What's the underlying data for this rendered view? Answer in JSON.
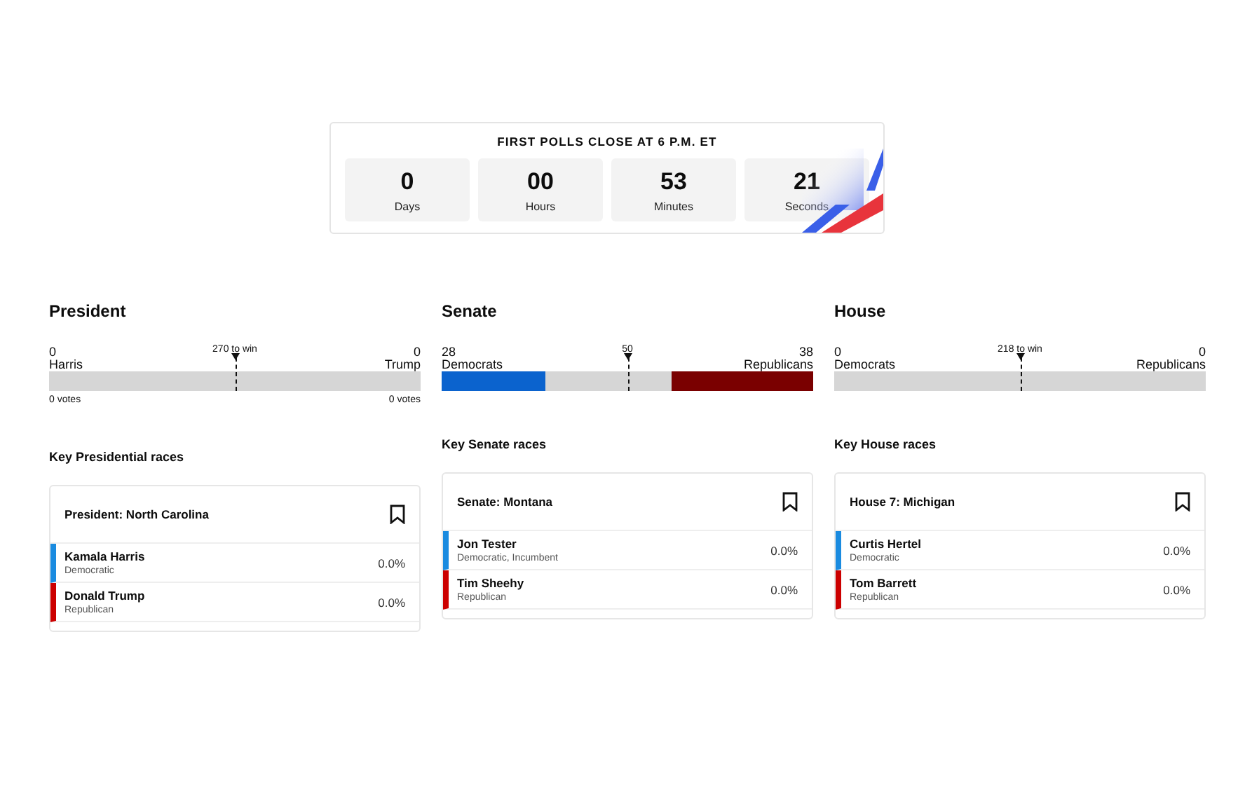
{
  "countdown": {
    "title": "FIRST POLLS CLOSE AT 6 P.M. ET",
    "units": [
      {
        "value": "0",
        "label": "Days"
      },
      {
        "value": "00",
        "label": "Hours"
      },
      {
        "value": "53",
        "label": "Minutes"
      },
      {
        "value": "21",
        "label": "Seconds"
      }
    ]
  },
  "sections": [
    {
      "title": "President",
      "left": {
        "count": "0",
        "name": "Harris",
        "votes": "0 votes"
      },
      "right": {
        "count": "0",
        "name": "Trump",
        "votes": "0 votes"
      },
      "marker": "270 to win",
      "key_title": "Key Presidential races",
      "race": {
        "title": "President: North Carolina",
        "candidates": [
          {
            "name": "Kamala Harris",
            "detail": "Democratic",
            "pct": "0.0%",
            "color": "#1a8be0"
          },
          {
            "name": "Donald Trump",
            "detail": "Republican",
            "pct": "0.0%",
            "color": "#cc0000"
          }
        ]
      }
    },
    {
      "title": "Senate",
      "left": {
        "count": "28",
        "name": "Democrats",
        "fill": {
          "level": 0.28
        }
      },
      "right": {
        "count": "38",
        "name": "Republicans",
        "fill": {
          "level": 0.38
        }
      },
      "marker": "50",
      "key_title": "Key Senate races",
      "race": {
        "title": "Senate: Montana",
        "candidates": [
          {
            "name": "Jon Tester",
            "detail": "Democratic, Incumbent",
            "pct": "0.0%",
            "color": "#1a8be0"
          },
          {
            "name": "Tim Sheehy",
            "detail": "Republican",
            "pct": "0.0%",
            "color": "#cc0000"
          }
        ]
      }
    },
    {
      "title": "House",
      "left": {
        "count": "0",
        "name": "Democrats"
      },
      "right": {
        "count": "0",
        "name": "Republicans"
      },
      "marker": "218 to win",
      "key_title": "Key House races",
      "race": {
        "title": "House 7: Michigan",
        "candidates": [
          {
            "name": "Curtis Hertel",
            "detail": "Democratic",
            "pct": "0.0%",
            "color": "#1a8be0"
          },
          {
            "name": "Tom Barrett",
            "detail": "Republican",
            "pct": "0.0%",
            "color": "#cc0000"
          }
        ]
      }
    }
  ]
}
